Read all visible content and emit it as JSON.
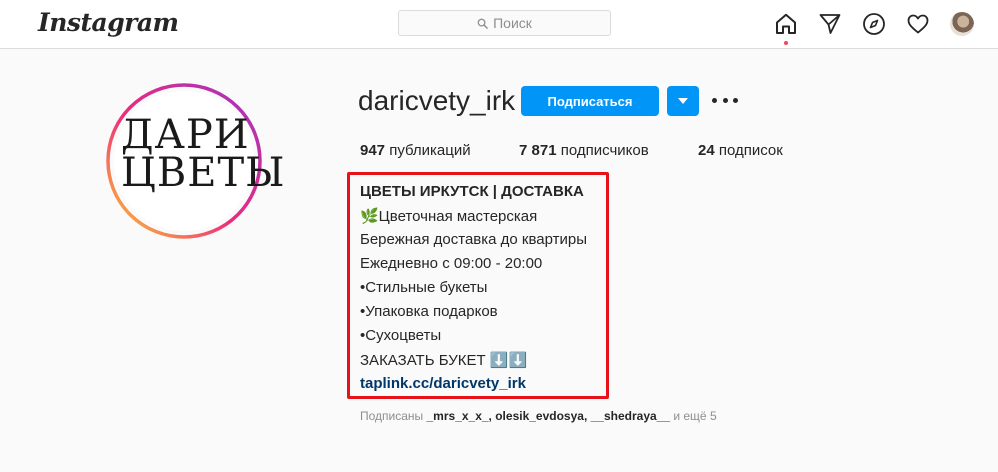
{
  "topbar": {
    "logo": "Instagram",
    "search_placeholder": "Поиск"
  },
  "icons": {
    "home": "home-icon",
    "direct": "paper-plane-icon",
    "explore": "compass-icon",
    "activity": "heart-icon",
    "profile": "avatar"
  },
  "profile": {
    "picture_text_line1": "ДАРИ",
    "picture_text_line2": "ЦВЕТЫ",
    "username": "daricvety_irk",
    "follow_label": "Подписаться",
    "stats": {
      "posts_count": "947",
      "posts_label": "публикаций",
      "followers_count": "7 871",
      "followers_label": "подписчиков",
      "following_count": "24",
      "following_label": "подписок"
    }
  },
  "bio": {
    "title": "ЦВЕТЫ ИРКУТСК | ДОСТАВКА",
    "line1": "🌿Цветочная мастерская",
    "line2": "Бережная доставка до квартиры",
    "line3": "Ежедневно с 09:00 - 20:00",
    "line4": "•Стильные букеты",
    "line5": "•Упаковка подарков",
    "line6": "•Сухоцветы",
    "line7": "ЗАКАЗАТЬ БУКЕТ ⬇️⬇️",
    "link": "taplink.cc/daricvety_irk"
  },
  "followed_by": {
    "prefix": "Подписаны ",
    "names": "_mrs_x_x_, olesik_evdosya, __shedraya__",
    "suffix": " и ещё 5"
  },
  "colors": {
    "accent": "#0095f6",
    "highlight_box": "#e8121b",
    "link": "#00376b"
  }
}
